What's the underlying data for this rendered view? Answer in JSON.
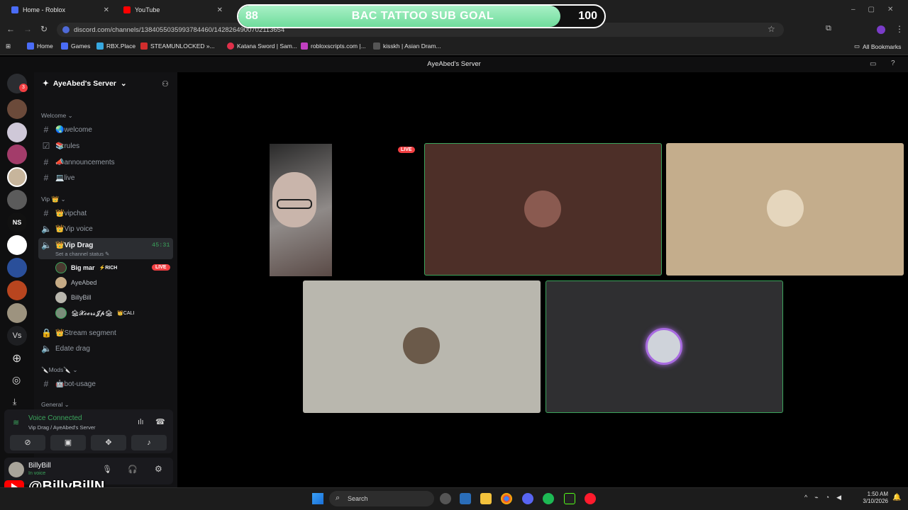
{
  "browser": {
    "tabs": [
      {
        "title": "Home - Roblox"
      },
      {
        "title": "YouTube"
      }
    ],
    "url": "discord.com/channels/1384055035993784460/1428264900702113654",
    "bookmarks": [
      "Home",
      "Games",
      "RBX.Place",
      "STEAMUNLOCKED »...",
      "Katana Sword | Sam...",
      "robloxscripts.com |...",
      "kisskh | Asian Dram..."
    ],
    "all_bookmarks": "All Bookmarks"
  },
  "goal": {
    "current": "88",
    "title": "BAC TATTOO SUB GOAL",
    "target": "100",
    "progress": 0.88
  },
  "discord": {
    "window_title": "AyeAbed's Server",
    "server_name": "AyeAbed's Server",
    "notification_count": "3",
    "categories": {
      "welcome": "Welcome",
      "vip": "Vip 👑",
      "mods": "🔪Mods🔪",
      "general": "General"
    },
    "channels": {
      "welcome": "🌏welcome",
      "rules": "📚rules",
      "announcements": "📣announcements",
      "live": "💻live",
      "vipchat": "👑vipchat",
      "vip_voice": "👑Vip voice",
      "vip_drag": "👑Vip Drag",
      "vip_drag_timer": "45:31",
      "vip_drag_status": "Set a channel status",
      "stream_segment": "👑Stream segment",
      "edate_drag": "Edate drag",
      "bot_usage": "🤖bot-usage"
    },
    "members": [
      {
        "name": "Big mar",
        "tag": "⚡RICH",
        "live": "LIVE"
      },
      {
        "name": "AyeAbed",
        "tag": "",
        "live": ""
      },
      {
        "name": "BillyBill",
        "tag": "",
        "live": ""
      },
      {
        "name": "🏚𝓧𝓸𝓮𝓻𝓼𝓙𝓹🏚",
        "tag": "👑CALI",
        "live": ""
      }
    ],
    "voice": {
      "status": "Voice Connected",
      "location": "Vip Drag / AyeAbed's Server"
    },
    "user": {
      "name": "BillyBill",
      "status": "In voice"
    },
    "stream_live_badge": "LIVE"
  },
  "overlay": {
    "handle": "@BillyBillN"
  },
  "taskbar": {
    "search_placeholder": "Search",
    "time": "1:50 AM",
    "date": "3/10/2026"
  }
}
